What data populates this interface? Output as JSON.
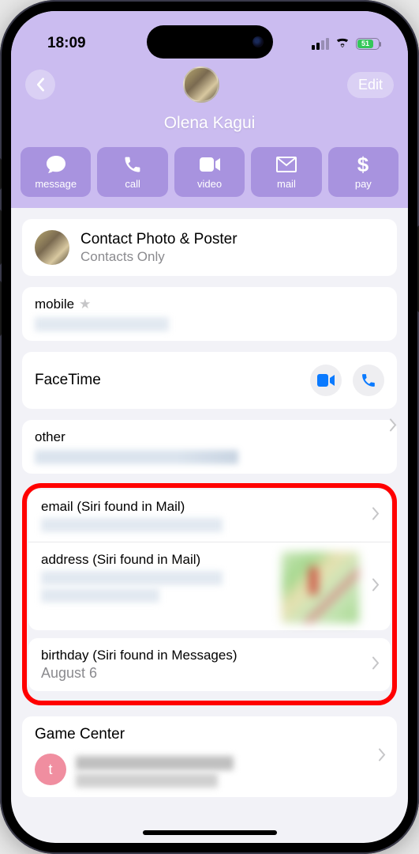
{
  "status": {
    "time": "18:09",
    "battery_pct": "51"
  },
  "header": {
    "edit_label": "Edit",
    "contact_name": "Olena Kagui",
    "actions": {
      "message": "message",
      "call": "call",
      "video": "video",
      "mail": "mail",
      "pay": "pay"
    }
  },
  "photo_poster": {
    "title": "Contact Photo & Poster",
    "subtitle": "Contacts Only"
  },
  "mobile": {
    "label": "mobile"
  },
  "facetime": {
    "label": "FaceTime"
  },
  "other": {
    "label": "other"
  },
  "siri_email": {
    "label": "email (Siri found in Mail)"
  },
  "siri_address": {
    "label": "address (Siri found in Mail)"
  },
  "siri_birthday": {
    "label": "birthday (Siri found in Messages)",
    "value": "August 6"
  },
  "game_center": {
    "title": "Game Center",
    "avatar_initial": "t"
  }
}
